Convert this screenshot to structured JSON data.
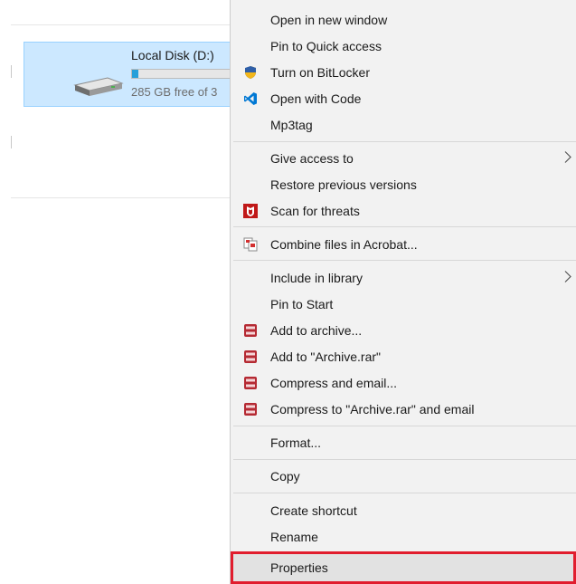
{
  "drive": {
    "name": "Local Disk (D:)",
    "free_text": "285 GB free of 3",
    "used_fraction": 0.06,
    "bar_color": "#26a0da",
    "tile_color": "#cce8ff"
  },
  "context_menu": {
    "items": [
      {
        "label": "Open in new window"
      },
      {
        "label": "Pin to Quick access"
      },
      {
        "label": "Turn on BitLocker",
        "icon": "shield-icon"
      },
      {
        "label": "Open with Code",
        "icon": "vscode-icon"
      },
      {
        "label": "Mp3tag"
      },
      {
        "label": "Give access to",
        "submenu": true
      },
      {
        "label": "Restore previous versions"
      },
      {
        "label": "Scan for threats",
        "icon": "mcafee-icon"
      },
      {
        "label": "Combine files in Acrobat...",
        "icon": "acrobat-icon"
      },
      {
        "label": "Include in library",
        "submenu": true
      },
      {
        "label": "Pin to Start"
      },
      {
        "label": "Add to archive...",
        "icon": "winrar-icon"
      },
      {
        "label": "Add to \"Archive.rar\"",
        "icon": "winrar-icon"
      },
      {
        "label": "Compress and email...",
        "icon": "winrar-icon"
      },
      {
        "label": "Compress to \"Archive.rar\" and email",
        "icon": "winrar-icon"
      },
      {
        "label": "Format..."
      },
      {
        "label": "Copy"
      },
      {
        "label": "Create shortcut"
      },
      {
        "label": "Rename"
      },
      {
        "label": "Properties",
        "highlighted": true
      }
    ]
  },
  "colors": {
    "menu_bg": "#f2f2f2",
    "highlight_border": "#e11d2e",
    "vscode_blue": "#0078d4",
    "mcafee_red": "#c01818",
    "winrar_red": "#b52a33"
  }
}
